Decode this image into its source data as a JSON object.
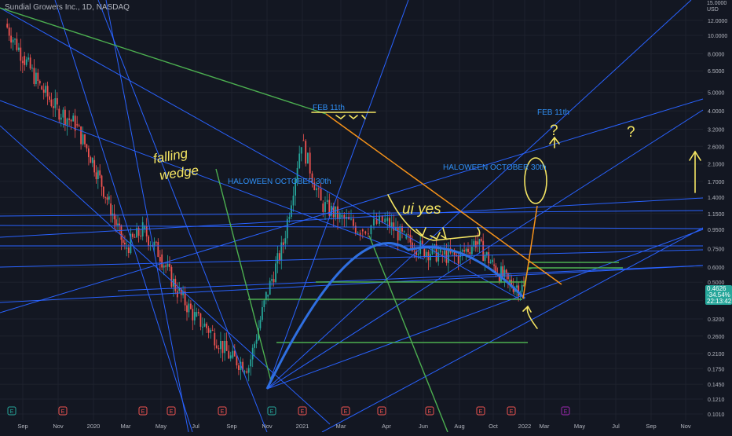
{
  "header": {
    "title": "Sundial Growers Inc., 1D, NASDAQ"
  },
  "price_axis": {
    "currency_top": "15.0000",
    "currency_unit": "USD",
    "ticks": [
      {
        "label": "12.0000",
        "value": 12.0
      },
      {
        "label": "10.0000",
        "value": 10.0
      },
      {
        "label": "8.0000",
        "value": 8.0
      },
      {
        "label": "6.5000",
        "value": 6.5
      },
      {
        "label": "5.0000",
        "value": 5.0
      },
      {
        "label": "4.0000",
        "value": 4.0
      },
      {
        "label": "3.2000",
        "value": 3.2
      },
      {
        "label": "2.6000",
        "value": 2.6
      },
      {
        "label": "2.1000",
        "value": 2.1
      },
      {
        "label": "1.7000",
        "value": 1.7
      },
      {
        "label": "1.4000",
        "value": 1.4
      },
      {
        "label": "1.1500",
        "value": 1.15
      },
      {
        "label": "0.9500",
        "value": 0.95
      },
      {
        "label": "0.7500",
        "value": 0.75
      },
      {
        "label": "0.6000",
        "value": 0.6
      },
      {
        "label": "0.5000",
        "value": 0.5
      },
      {
        "label": "0.4000",
        "value": 0.4
      },
      {
        "label": "0.3200",
        "value": 0.32
      },
      {
        "label": "0.2600",
        "value": 0.26
      },
      {
        "label": "0.2100",
        "value": 0.21
      },
      {
        "label": "0.1750",
        "value": 0.175
      },
      {
        "label": "0.1450",
        "value": 0.145
      },
      {
        "label": "0.1210",
        "value": 0.121
      },
      {
        "label": "0.1010",
        "value": 0.101
      }
    ]
  },
  "current_price": {
    "value_label": "0.4626",
    "change_label": "-34.54%",
    "time_label": "22:13:42",
    "color": "#26a69a"
  },
  "time_axis": {
    "labels": [
      "Sep",
      "Nov",
      "2020",
      "Mar",
      "May",
      "Jul",
      "Sep",
      "Nov",
      "2021",
      "Mar",
      "Apr",
      "Jun",
      "Aug",
      "Oct",
      "2022",
      "Mar",
      "May",
      "Jul",
      "Sep",
      "Nov"
    ]
  },
  "annotations": {
    "falling_wedge": [
      "falling",
      "wedge"
    ],
    "halloween_left": "HALOWEEN OCTOBER 30th",
    "halloween_right": "HALOWEEN OCTOBER 30th",
    "feb_left": "FEB 11th",
    "feb_right": "FEB 11th",
    "uiyes": "ui yes",
    "question_marks": [
      "?",
      "?"
    ]
  },
  "event_markers": [
    "E",
    "E",
    "E",
    "E",
    "E",
    "E",
    "E",
    "E",
    "E",
    "E",
    "E",
    "E",
    "E",
    "E",
    "E"
  ],
  "colors": {
    "background": "#131722",
    "grid": "#1e222d",
    "trend_blue": "#2962ff",
    "arc_blue": "#2f6fe0",
    "support_green": "#4caf50",
    "resistance_orange": "#f7931a",
    "drawing_yellow": "#f5e663",
    "up_candle": "#26a69a",
    "down_candle": "#ef5350",
    "earnings_red": "#ef5350",
    "earnings_green": "#26a69a",
    "dividend_purple": "#9c27b0"
  },
  "chart_data": {
    "type": "candlestick",
    "title": "Sundial Growers Inc., 1D, NASDAQ",
    "yscale": "log",
    "ylim": [
      0.1,
      15.0
    ],
    "series": [
      {
        "approx_close": [
          [
            "2019-09",
            11.5
          ],
          [
            "2019-10",
            7.8
          ],
          [
            "2019-11",
            5.4
          ],
          [
            "2019-12",
            4.1
          ],
          [
            "2020-01",
            3.4
          ],
          [
            "2020-02",
            2.2
          ],
          [
            "2020-03",
            1.3
          ],
          [
            "2020-04",
            0.75
          ],
          [
            "2020-05",
            0.95
          ],
          [
            "2020-06",
            0.7
          ],
          [
            "2020-07",
            0.45
          ],
          [
            "2020-08",
            0.33
          ],
          [
            "2020-09",
            0.27
          ],
          [
            "2020-10",
            0.2
          ],
          [
            "2020-11",
            0.18
          ],
          [
            "2020-12",
            0.42
          ],
          [
            "2021-01",
            0.8
          ],
          [
            "2021-02",
            2.8
          ],
          [
            "2021-03",
            1.3
          ],
          [
            "2021-04",
            1.1
          ],
          [
            "2021-05",
            0.95
          ],
          [
            "2021-06",
            1.05
          ],
          [
            "2021-07",
            0.85
          ],
          [
            "2021-08",
            0.75
          ],
          [
            "2021-09",
            0.7
          ],
          [
            "2021-10",
            0.68
          ],
          [
            "2021-11",
            0.82
          ],
          [
            "2021-12",
            0.62
          ],
          [
            "2022-01",
            0.5
          ],
          [
            "2022-02",
            0.4626
          ]
        ]
      }
    ]
  }
}
